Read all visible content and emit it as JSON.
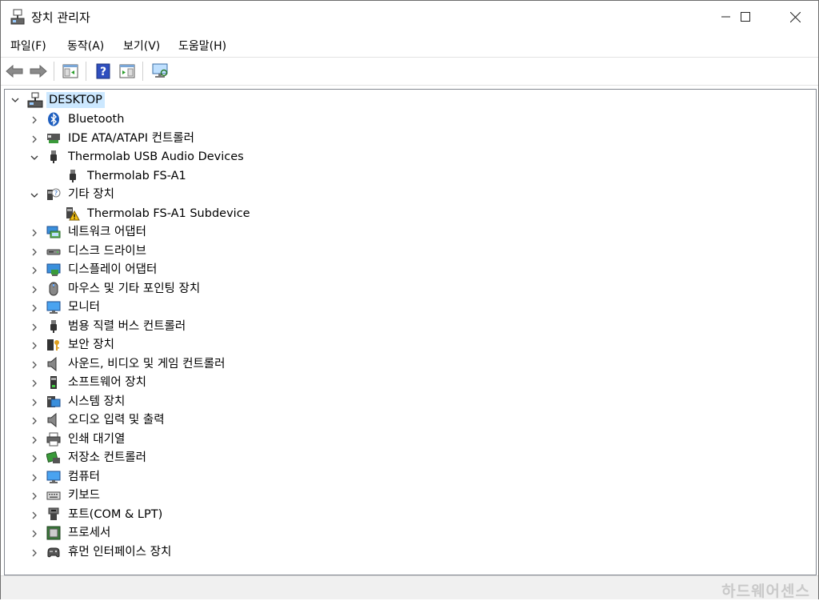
{
  "window": {
    "title": "장치 관리자"
  },
  "controls": {
    "minimize": "—",
    "maximize": "☐",
    "close": "✕"
  },
  "menu": [
    "파일(F)",
    "동작(A)",
    "보기(V)",
    "도움말(H)"
  ],
  "toolbar": [
    "back-icon",
    "forward-icon",
    "properties-panel-icon",
    "help-icon",
    "action-pane-icon",
    "scan-hardware-icon"
  ],
  "tree": {
    "root": "DESKTOP",
    "items": [
      {
        "label": "Bluetooth",
        "icon": "bluetooth-icon",
        "expanded": false
      },
      {
        "label": "IDE ATA/ATAPI 컨트롤러",
        "icon": "ide-controller-icon",
        "expanded": false
      },
      {
        "label": "Thermolab USB Audio Devices",
        "icon": "usb-plug-icon",
        "expanded": true
      },
      {
        "label": "Thermolab FS-A1",
        "icon": "usb-plug-icon",
        "child": true
      },
      {
        "label": "기타 장치",
        "icon": "unknown-device-icon",
        "expanded": true
      },
      {
        "label": "Thermolab FS-A1 Subdevice",
        "icon": "warning-device-icon",
        "child": true
      },
      {
        "label": "네트워크 어댑터",
        "icon": "network-adapter-icon",
        "expanded": false
      },
      {
        "label": "디스크 드라이브",
        "icon": "disk-drive-icon",
        "expanded": false
      },
      {
        "label": "디스플레이 어댑터",
        "icon": "display-adapter-icon",
        "expanded": false
      },
      {
        "label": "마우스 및 기타 포인팅 장치",
        "icon": "mouse-icon",
        "expanded": false
      },
      {
        "label": "모니터",
        "icon": "monitor-icon",
        "expanded": false
      },
      {
        "label": "범용 직렬 버스 컨트롤러",
        "icon": "usb-controller-icon",
        "expanded": false
      },
      {
        "label": "보안 장치",
        "icon": "security-device-icon",
        "expanded": false
      },
      {
        "label": "사운드, 비디오 및 게임 컨트롤러",
        "icon": "speaker-icon",
        "expanded": false
      },
      {
        "label": "소프트웨어 장치",
        "icon": "software-device-icon",
        "expanded": false
      },
      {
        "label": "시스템 장치",
        "icon": "system-device-icon",
        "expanded": false
      },
      {
        "label": "오디오 입력 및 출력",
        "icon": "speaker-icon",
        "expanded": false
      },
      {
        "label": "인쇄 대기열",
        "icon": "printer-icon",
        "expanded": false
      },
      {
        "label": "저장소 컨트롤러",
        "icon": "storage-controller-icon",
        "expanded": false
      },
      {
        "label": "컴퓨터",
        "icon": "computer-icon",
        "expanded": false
      },
      {
        "label": "키보드",
        "icon": "keyboard-icon",
        "expanded": false
      },
      {
        "label": "포트(COM & LPT)",
        "icon": "port-icon",
        "expanded": false
      },
      {
        "label": "프로세서",
        "icon": "processor-icon",
        "expanded": false
      },
      {
        "label": "휴먼 인터페이스 장치",
        "icon": "hid-icon",
        "expanded": false
      }
    ]
  },
  "watermark": "하드웨어센스",
  "colors": {
    "selection": "#cce8ff",
    "accent": "#0078d7"
  }
}
